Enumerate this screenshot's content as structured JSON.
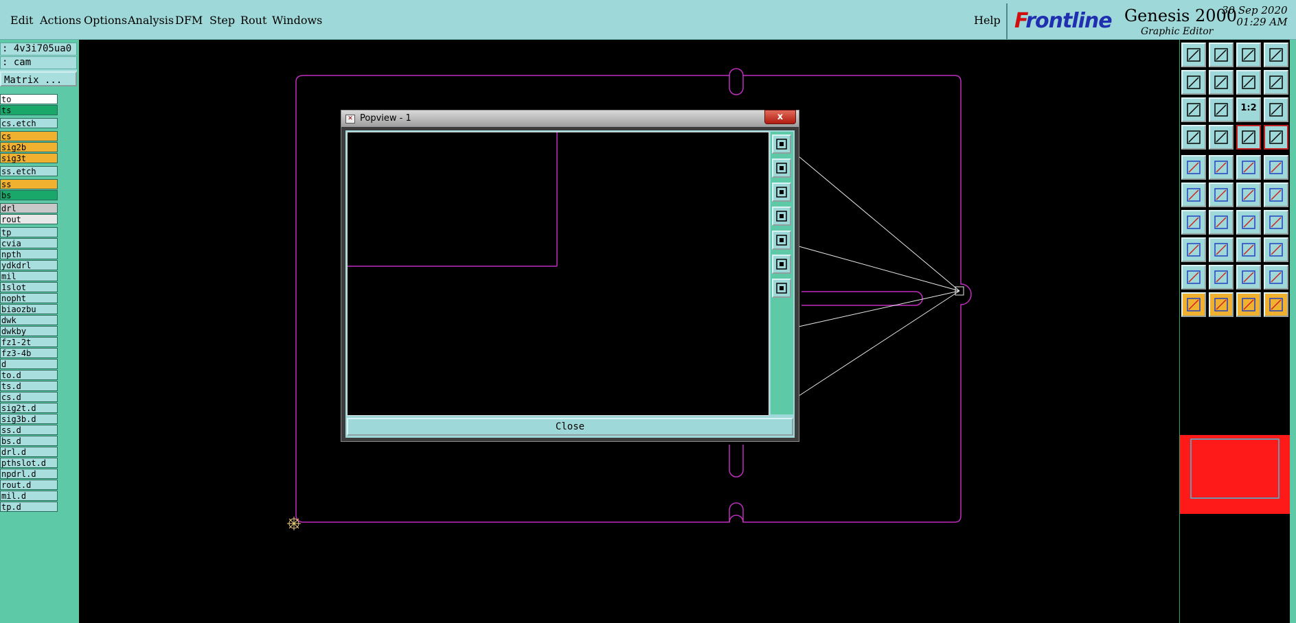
{
  "menubar": {
    "items": [
      "Edit",
      "Actions",
      "Options",
      "Analysis",
      "DFM",
      "Step",
      "Rout",
      "Windows"
    ],
    "help": "Help"
  },
  "brand": {
    "logo_prefix": "F",
    "logo_rest": "rontline",
    "product": "Genesis 2000",
    "date": "30 Sep 2020",
    "time": "01:29 AM",
    "subtitle": "Graphic Editor"
  },
  "left_panel": {
    "job": ": 4v3i705ua0",
    "step": ": cam",
    "matrix_button": "Matrix ...",
    "layers": [
      {
        "name": "to",
        "color": "#ffffff"
      },
      {
        "name": "ts",
        "color": "#1aa86a"
      },
      {
        "name": "cs.etch",
        "color": "#a8dede",
        "gap": true
      },
      {
        "name": "cs",
        "color": "#f0b030",
        "gap": true
      },
      {
        "name": "sig2b",
        "color": "#f0b030"
      },
      {
        "name": "sig3t",
        "color": "#f0b030"
      },
      {
        "name": "ss.etch",
        "color": "#a8dede",
        "gap": true
      },
      {
        "name": "ss",
        "color": "#f0b030",
        "gap": true
      },
      {
        "name": "bs",
        "color": "#1aa86a"
      },
      {
        "name": "drl",
        "color": "#c8c8c8",
        "gap": true
      },
      {
        "name": "rout",
        "color": "#e8e8e8"
      },
      {
        "name": "tp",
        "color": "#a8dede",
        "gap": true
      },
      {
        "name": "cvia",
        "color": "#a8dede"
      },
      {
        "name": "npth",
        "color": "#a8dede"
      },
      {
        "name": "ydkdrl",
        "color": "#a8dede"
      },
      {
        "name": "mil",
        "color": "#a8dede"
      },
      {
        "name": "1slot",
        "color": "#a8dede"
      },
      {
        "name": "nopht",
        "color": "#a8dede"
      },
      {
        "name": "biaozbu",
        "color": "#a8dede"
      },
      {
        "name": "dwk",
        "color": "#a8dede"
      },
      {
        "name": "dwkby",
        "color": "#a8dede"
      },
      {
        "name": "fz1-2t",
        "color": "#a8dede"
      },
      {
        "name": "fz3-4b",
        "color": "#a8dede"
      },
      {
        "name": "d",
        "color": "#a8dede"
      },
      {
        "name": "to.d",
        "color": "#a8dede"
      },
      {
        "name": "ts.d",
        "color": "#a8dede"
      },
      {
        "name": "cs.d",
        "color": "#a8dede"
      },
      {
        "name": "sig2t.d",
        "color": "#a8dede"
      },
      {
        "name": "sig3b.d",
        "color": "#a8dede"
      },
      {
        "name": "ss.d",
        "color": "#a8dede"
      },
      {
        "name": "bs.d",
        "color": "#a8dede"
      },
      {
        "name": "drl.d",
        "color": "#a8dede"
      },
      {
        "name": "pthslot.d",
        "color": "#a8dede"
      },
      {
        "name": "npdrl.d",
        "color": "#a8dede"
      },
      {
        "name": "rout.d",
        "color": "#a8dede"
      },
      {
        "name": "mil.d",
        "color": "#a8dede"
      },
      {
        "name": "tp.d",
        "color": "#a8dede"
      }
    ]
  },
  "popview": {
    "title": "Popview - 1",
    "close_x": "x",
    "close_button": "Close",
    "tools": [
      "zoom-fit-icon",
      "pan-up-icon",
      "pan-down-icon",
      "pan-left-icon",
      "pan-right-icon",
      "zoom-out-icon",
      "zoom-in-icon"
    ]
  },
  "tools": [
    "pan-up-icon",
    "pan-down-icon",
    "home-icon",
    "window-icon",
    "pan-left-icon",
    "pan-right-icon",
    "zoom-back-icon",
    "redraw-icon",
    "zoom-fit-icon",
    "zoom-icon",
    "scale-1-2-label",
    "help-icon",
    "measure-icon",
    "probe-icon",
    "layer-red-icon",
    "layer-red-2-icon",
    "pad-icon",
    "line-icon",
    "ruler-icon",
    "dot-icon",
    "connect-icon",
    "cross-icon",
    "move-point-icon",
    "move-point-2-icon",
    "angle-icon",
    "slash-icon",
    "arc-icon",
    "mirror-icon",
    "feature-icon",
    "cut-icon",
    "snap-icon",
    "select-icon",
    "triangle-icon",
    "triangle-2-icon",
    "triangle-3-icon",
    "triangle-4-icon",
    "pointer-icon",
    "pointer-box-icon",
    "pointer-select-icon",
    "pointer-route-icon"
  ],
  "scale_label": "1:2"
}
